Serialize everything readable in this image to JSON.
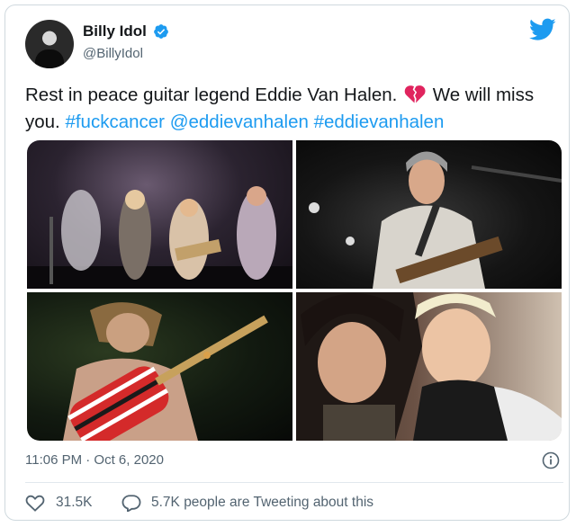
{
  "author": {
    "name": "Billy Idol",
    "handle": "@BillyIdol"
  },
  "tweet": {
    "text_before": "Rest in peace guitar legend Eddie Van Halen.",
    "text_after": "We will miss you.",
    "links": [
      "#fuckcancer",
      "@eddievanhalen",
      "#eddievanhalen"
    ],
    "emoji": "broken-heart"
  },
  "media": {
    "photos": [
      "concert-stage-photo",
      "eddie-smiling-guitar-photo",
      "eddie-striped-guitar-photo",
      "eddie-billy-closeup-photo"
    ]
  },
  "meta": {
    "timestamp": "11:06 PM · Oct 6, 2020"
  },
  "actions": {
    "likes": "31.5K",
    "conversation": "5.7K people are Tweeting about this"
  },
  "colors": {
    "link": "#1d9bf0",
    "verified": "#1d9bf0",
    "secondary_text": "#536471",
    "heart": "#e0245e"
  },
  "icons": [
    "verified-badge-icon",
    "twitter-bird-icon",
    "info-icon",
    "heart-icon",
    "speech-bubble-icon"
  ]
}
